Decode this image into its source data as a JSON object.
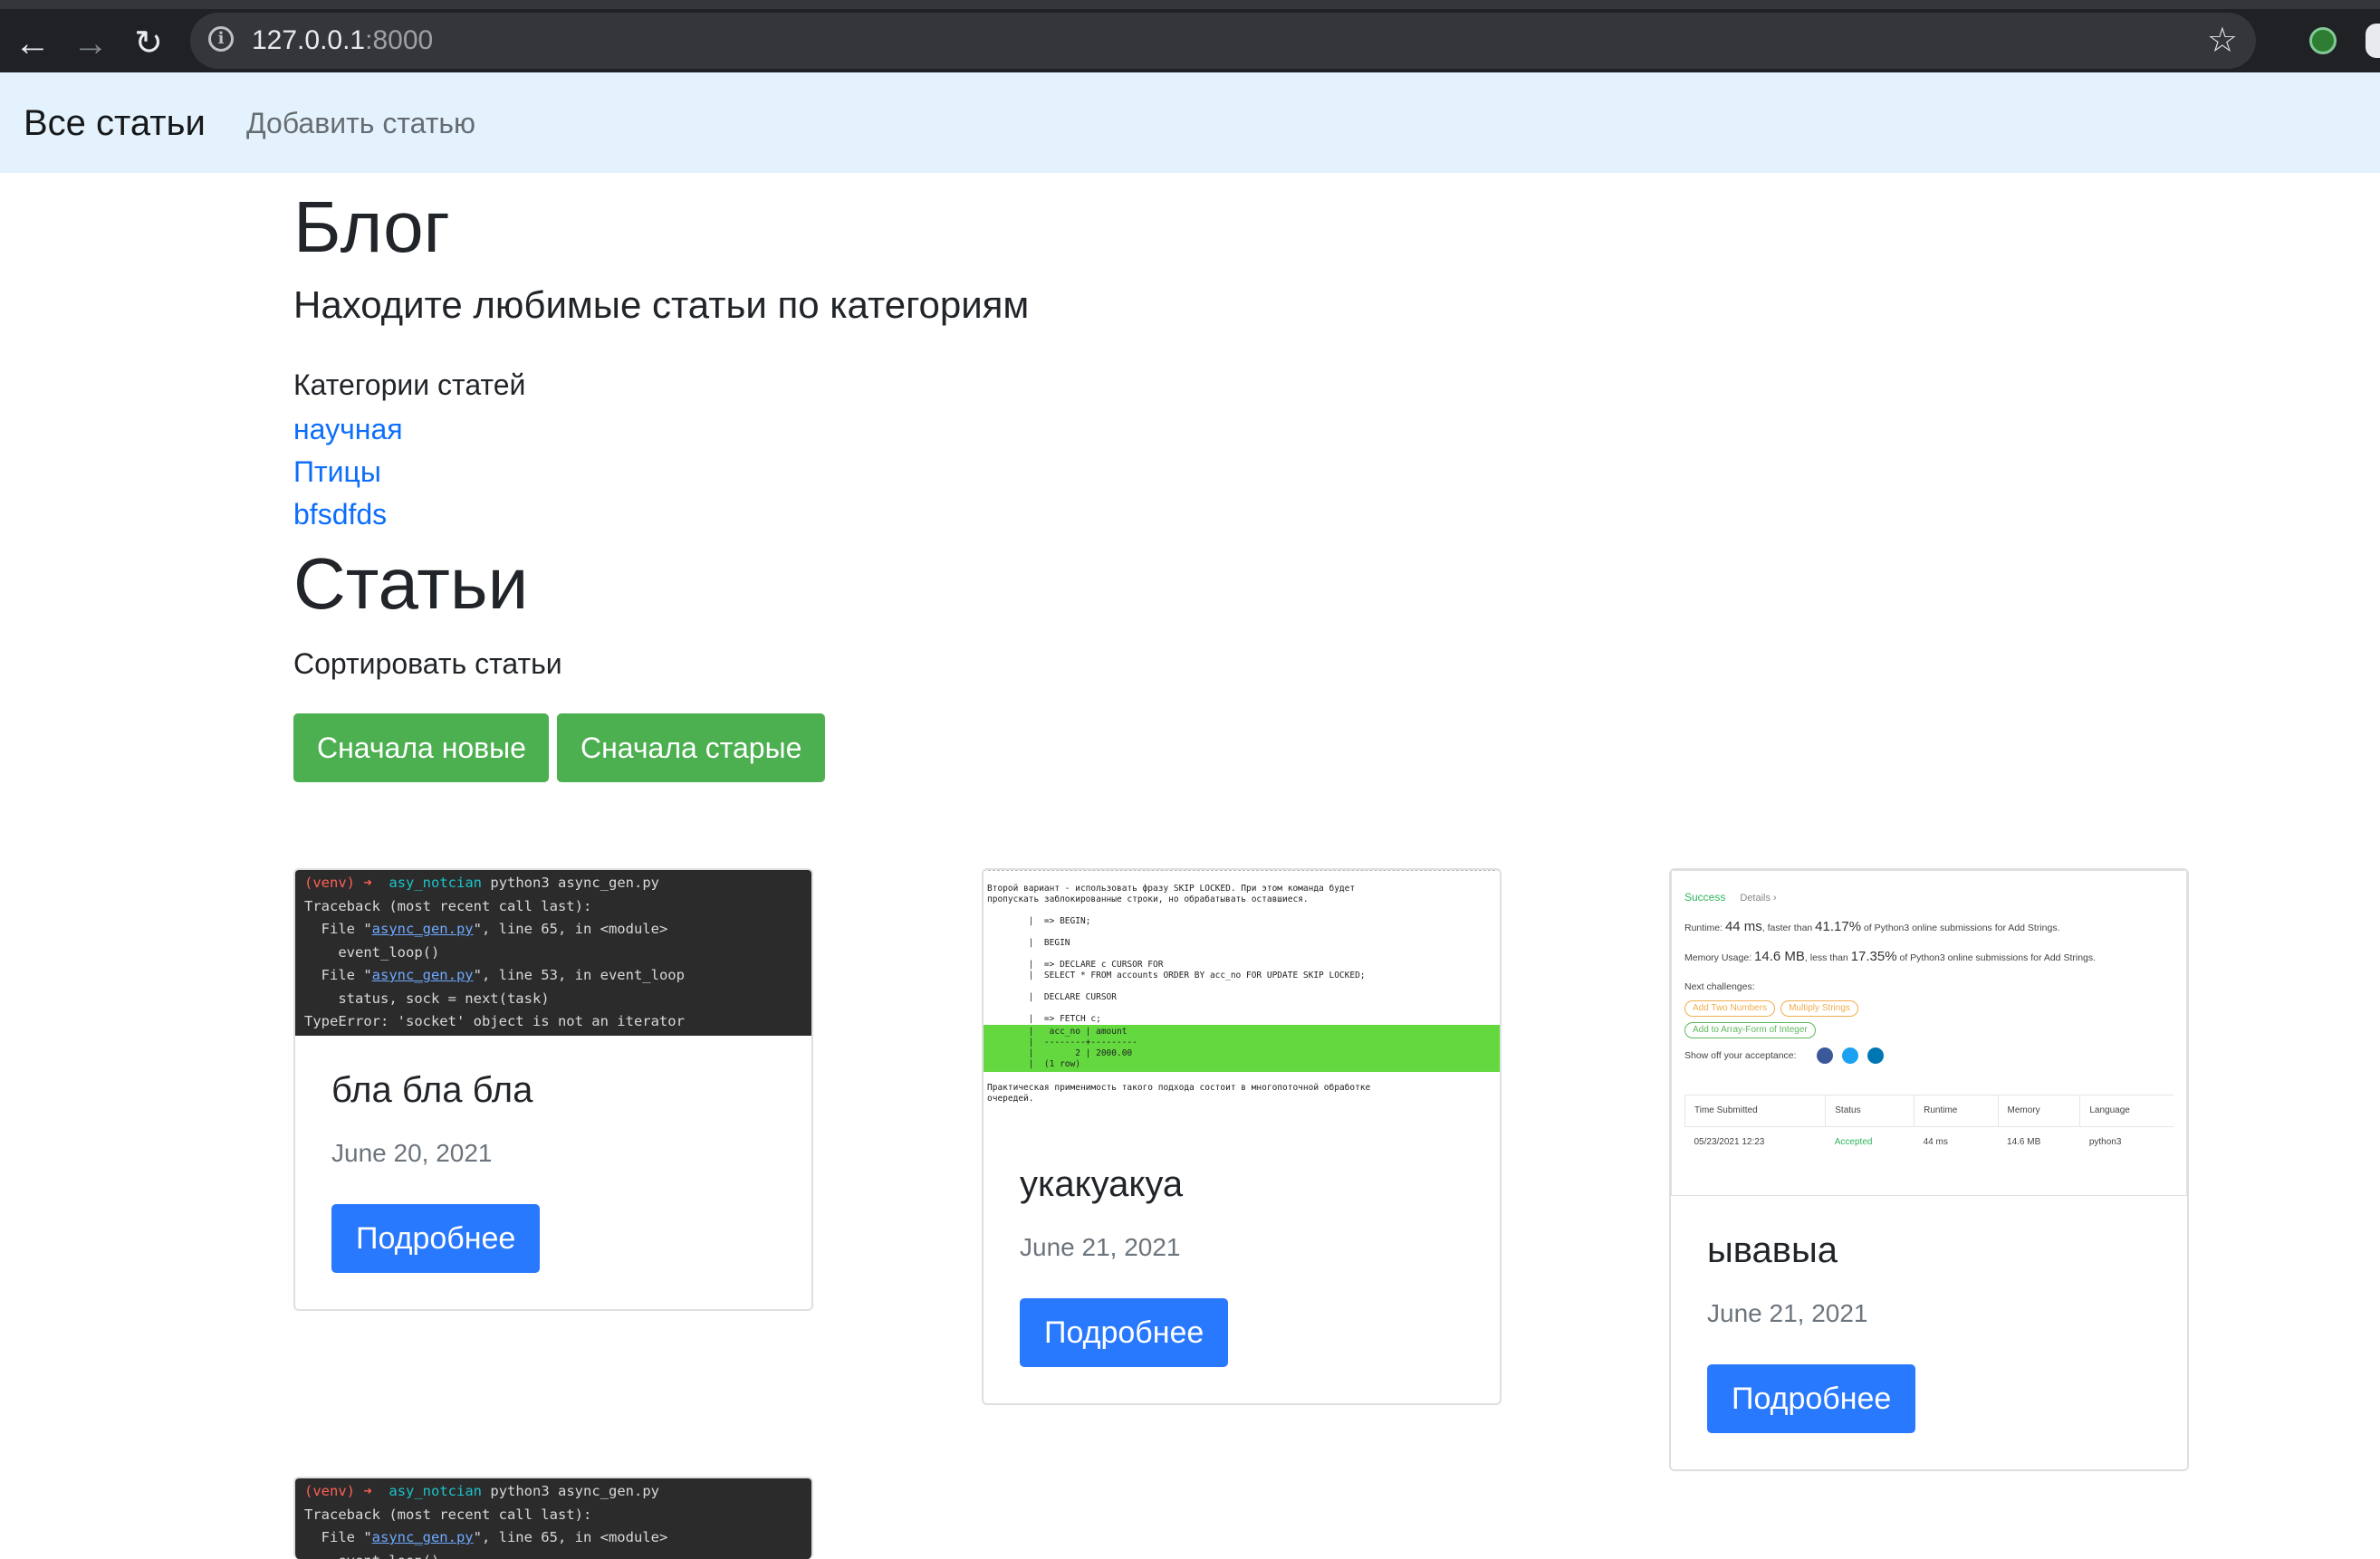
{
  "browser": {
    "url_host": "127.0.0.1",
    "url_port": ":8000"
  },
  "navbar": {
    "brand": "Все статьи",
    "add_article": "Добавить статью"
  },
  "header": {
    "title": "Блог",
    "lead": "Находите любимые статьи по категориям"
  },
  "categories": {
    "heading": "Категории статей",
    "items": [
      "научная",
      "Птицы",
      "bfsdfds"
    ]
  },
  "articles": {
    "title": "Статьи",
    "sort_label": "Сортировать статьи",
    "sort_newest": "Сначала новые",
    "sort_oldest": "Сначала старые",
    "cards": [
      {
        "title": "бла бла бла",
        "date": "June 20, 2021",
        "button": "Подробнее"
      },
      {
        "title": "укакуакуа",
        "date": "June 21, 2021",
        "button": "Подробнее"
      },
      {
        "title": "ывавыа",
        "date": "June 21, 2021",
        "button": "Подробнее"
      }
    ]
  },
  "thumb_terminal": {
    "venv": "(venv)",
    "arrow": "➜",
    "dir": "asy_notcian",
    "cmd": "python3 async_gen.py",
    "traceback": "Traceback (most recent call last):",
    "file_prefix": "  File \"",
    "file_name": "async_gen.py",
    "line1_suffix": "\", line 65, in <module>",
    "call1": "    event_loop()",
    "line2_suffix": "\", line 53, in event_loop",
    "call2": "    status, sock = next(task)",
    "error": "TypeError: 'socket' object is not an iterator"
  },
  "thumb_sql": {
    "intro1": "Второй вариант - использовать фразу SKIP LOCKED. При этом команда будет",
    "intro2": "пропускать заблокированные строки, но обрабатывать оставшиеся.",
    "l1": "        |  => BEGIN;",
    "l2": "        |  BEGIN",
    "l3": "        |  => DECLARE c CURSOR FOR",
    "l4": "        |  SELECT * FROM accounts ORDER BY acc_no FOR UPDATE SKIP LOCKED;",
    "l5": "        |  DECLARE CURSOR",
    "l6": "        |  => FETCH c;",
    "g1": "        |   acc_no | amount",
    "g2": "        |  --------+---------",
    "g3": "        |        2 | 2000.00",
    "g4": "        |  (1 row)",
    "outro1": "Практическая применимость такого подхода состоит в многопоточной обработке",
    "outro2": "очередей."
  },
  "thumb_leetcode": {
    "success": "Success",
    "details": "Details ›",
    "runtime_label": "Runtime:",
    "runtime_value": "44 ms",
    "runtime_mid": ", faster than",
    "runtime_pct": "41.17%",
    "runtime_tail": "of Python3 online submissions for Add Strings.",
    "memory_label": "Memory Usage:",
    "memory_value": "14.6 MB",
    "memory_mid": ", less than",
    "memory_pct": "17.35%",
    "memory_tail": "of Python3 online submissions for Add Strings.",
    "next": "Next challenges:",
    "tag1": "Add Two Numbers",
    "tag2": "Multiply Strings",
    "tag3": "Add to Array-Form of Integer",
    "showoff": "Show off your acceptance:",
    "col_time": "Time Submitted",
    "col_status": "Status",
    "col_runtime": "Runtime",
    "col_memory": "Memory",
    "col_lang": "Language",
    "row_time": "05/23/2021 12:23",
    "row_status": "Accepted",
    "row_runtime": "44 ms",
    "row_memory": "14.6 MB",
    "row_lang": "python3"
  },
  "colors": {
    "navbar_bg": "#e3f2fd",
    "sort_button": "#4caf50",
    "detail_button": "#2979ff",
    "category_link": "#0d6efd"
  }
}
